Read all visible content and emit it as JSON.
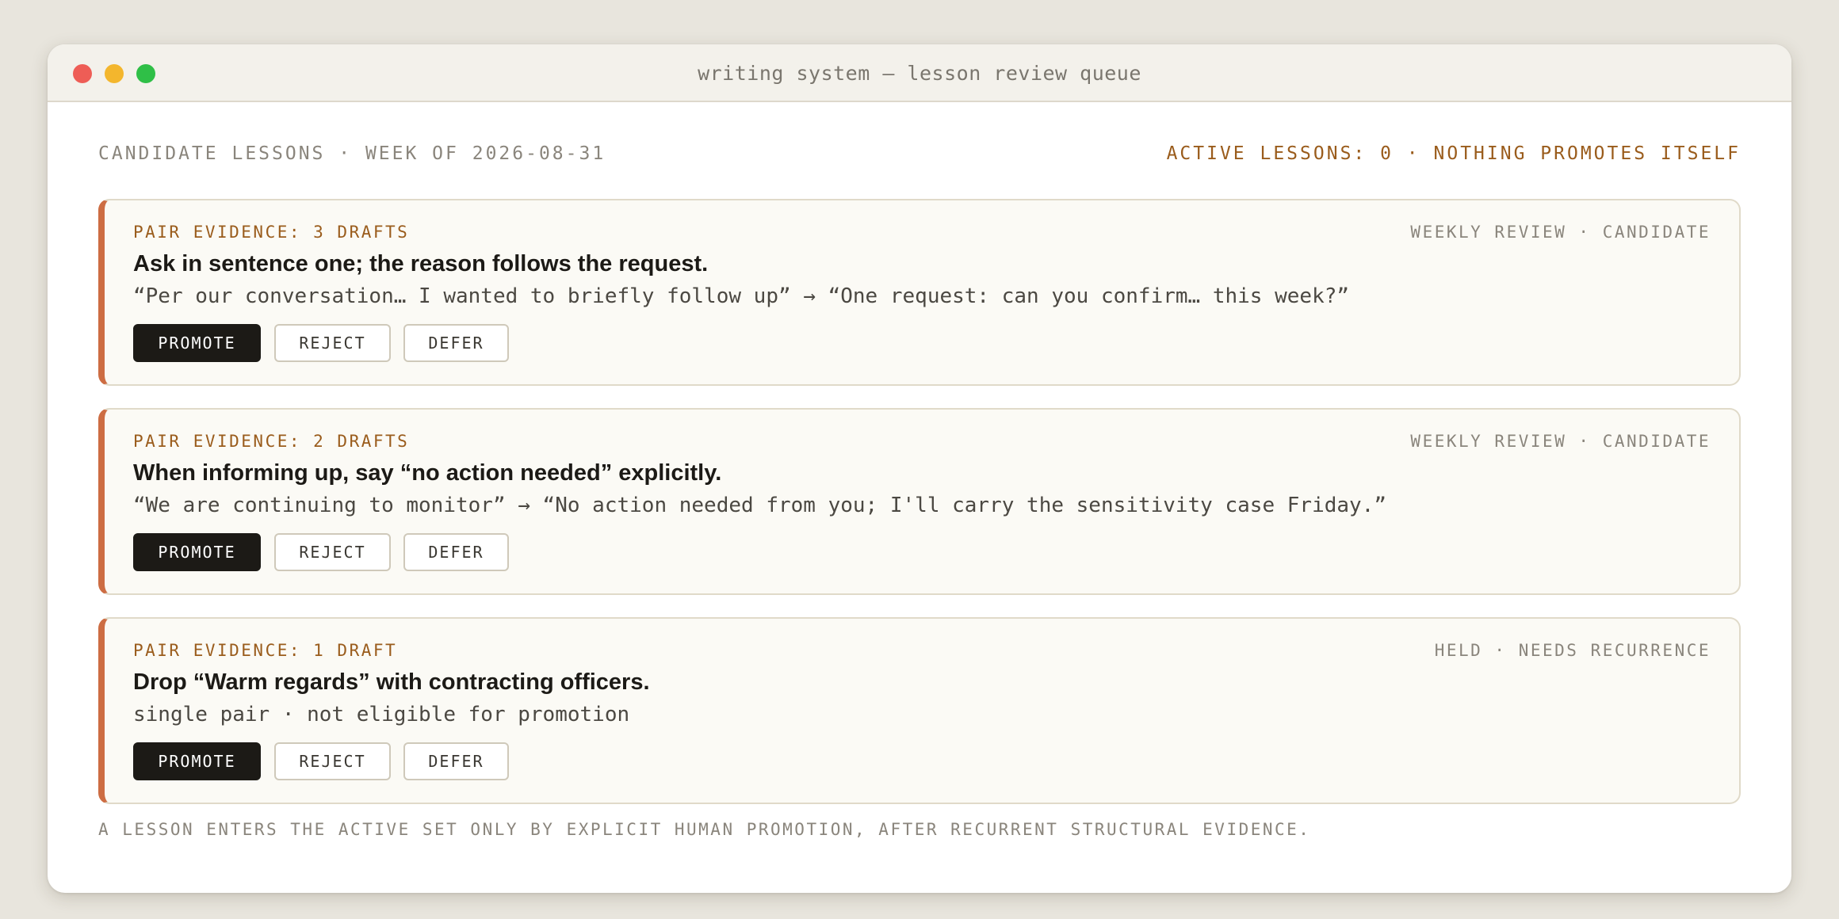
{
  "window": {
    "title": "writing system — lesson review queue"
  },
  "header": {
    "left": "CANDIDATE LESSONS · WEEK OF 2026-08-31",
    "right": "ACTIVE LESSONS: 0 · NOTHING PROMOTES ITSELF"
  },
  "cards": [
    {
      "evidence": "PAIR EVIDENCE: 3 DRAFTS",
      "status": "WEEKLY REVIEW · CANDIDATE",
      "title": "Ask in sentence one; the reason follows the request.",
      "detail": "“Per our conversation… I wanted to briefly follow up” → “One request: can you confirm… this week?”",
      "promote_label": "PROMOTE",
      "reject_label": "REJECT",
      "defer_label": "DEFER"
    },
    {
      "evidence": "PAIR EVIDENCE: 2 DRAFTS",
      "status": "WEEKLY REVIEW · CANDIDATE",
      "title": "When informing up, say “no action needed” explicitly.",
      "detail": "“We are continuing to monitor” → “No action needed from you; I'll carry the sensitivity case Friday.”",
      "promote_label": "PROMOTE",
      "reject_label": "REJECT",
      "defer_label": "DEFER"
    },
    {
      "evidence": "PAIR EVIDENCE: 1 DRAFT",
      "status": "HELD · NEEDS RECURRENCE",
      "title": "Drop “Warm regards” with contracting officers.",
      "detail": "single pair · not eligible for promotion",
      "promote_label": "PROMOTE",
      "reject_label": "REJECT",
      "defer_label": "DEFER"
    }
  ],
  "footer": {
    "note": "A LESSON ENTERS THE ACTIVE SET ONLY BY EXPLICIT HUMAN PROMOTION, AFTER RECURRENT STRUCTURAL EVIDENCE."
  },
  "colors": {
    "accent": "#cd6d43",
    "evidence_text": "#9a5c1c",
    "primary_button": "#1c1a16",
    "close_dot": "#ee5d56",
    "minimize_dot": "#f3b62d",
    "maximize_dot": "#2fbf47"
  }
}
